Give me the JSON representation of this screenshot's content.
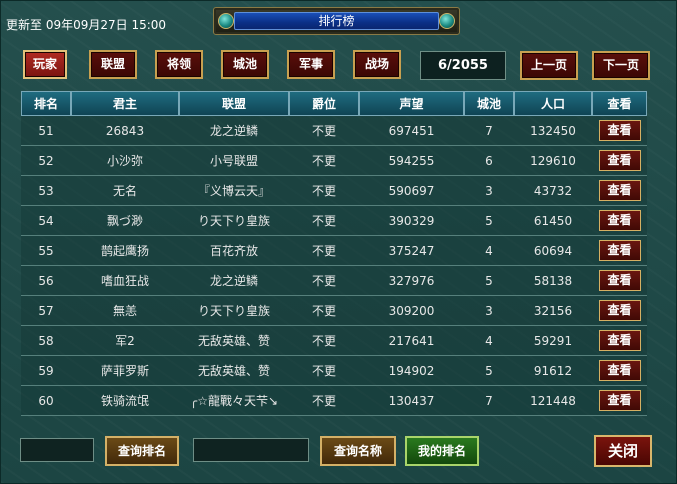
{
  "header": {
    "update_text": "更新至 09年09月27日 15:00",
    "title": "排行榜"
  },
  "tabs": [
    {
      "label": "玩家",
      "active": true
    },
    {
      "label": "联盟",
      "active": false
    },
    {
      "label": "将领",
      "active": false
    },
    {
      "label": "城池",
      "active": false
    },
    {
      "label": "军事",
      "active": false
    },
    {
      "label": "战场",
      "active": false
    }
  ],
  "pagination": {
    "page_info": "6/2055",
    "prev_label": "上一页",
    "next_label": "下一页"
  },
  "table": {
    "columns": [
      "排名",
      "君主",
      "联盟",
      "爵位",
      "声望",
      "城池",
      "人口",
      "查看"
    ],
    "view_label": "查看",
    "rows": [
      {
        "rank": "51",
        "lord": "26843",
        "alliance": "龙之逆鳞",
        "title": "不更",
        "prestige": "697451",
        "cities": "7",
        "population": "132450"
      },
      {
        "rank": "52",
        "lord": "小沙弥",
        "alliance": "小号联盟",
        "title": "不更",
        "prestige": "594255",
        "cities": "6",
        "population": "129610"
      },
      {
        "rank": "53",
        "lord": "无名",
        "alliance": "『义博云天』",
        "title": "不更",
        "prestige": "590697",
        "cities": "3",
        "population": "43732"
      },
      {
        "rank": "54",
        "lord": "飘づ渺",
        "alliance": "り天下り皇族",
        "title": "不更",
        "prestige": "390329",
        "cities": "5",
        "population": "61450"
      },
      {
        "rank": "55",
        "lord": "鹊起鹰扬",
        "alliance": "百花齐放",
        "title": "不更",
        "prestige": "375247",
        "cities": "4",
        "population": "60694"
      },
      {
        "rank": "56",
        "lord": "嗜血狂战",
        "alliance": "龙之逆鳞",
        "title": "不更",
        "prestige": "327976",
        "cities": "5",
        "population": "58138"
      },
      {
        "rank": "57",
        "lord": "無恙",
        "alliance": "り天下り皇族",
        "title": "不更",
        "prestige": "309200",
        "cities": "3",
        "population": "32156"
      },
      {
        "rank": "58",
        "lord": "军2",
        "alliance": "无敌英雄、赞",
        "title": "不更",
        "prestige": "217641",
        "cities": "4",
        "population": "59291"
      },
      {
        "rank": "59",
        "lord": "萨菲罗斯",
        "alliance": "无敌英雄、赞",
        "title": "不更",
        "prestige": "194902",
        "cities": "5",
        "population": "91612"
      },
      {
        "rank": "60",
        "lord": "铁骑流氓",
        "alliance": "╭☆龍戰々天芐↘",
        "title": "不更",
        "prestige": "130437",
        "cities": "7",
        "population": "121448"
      }
    ]
  },
  "footer": {
    "rank_input_value": "",
    "query_rank_label": "查询排名",
    "name_input_value": "",
    "query_name_label": "查询名称",
    "my_rank_label": "我的排名",
    "close_label": "关闭"
  }
}
